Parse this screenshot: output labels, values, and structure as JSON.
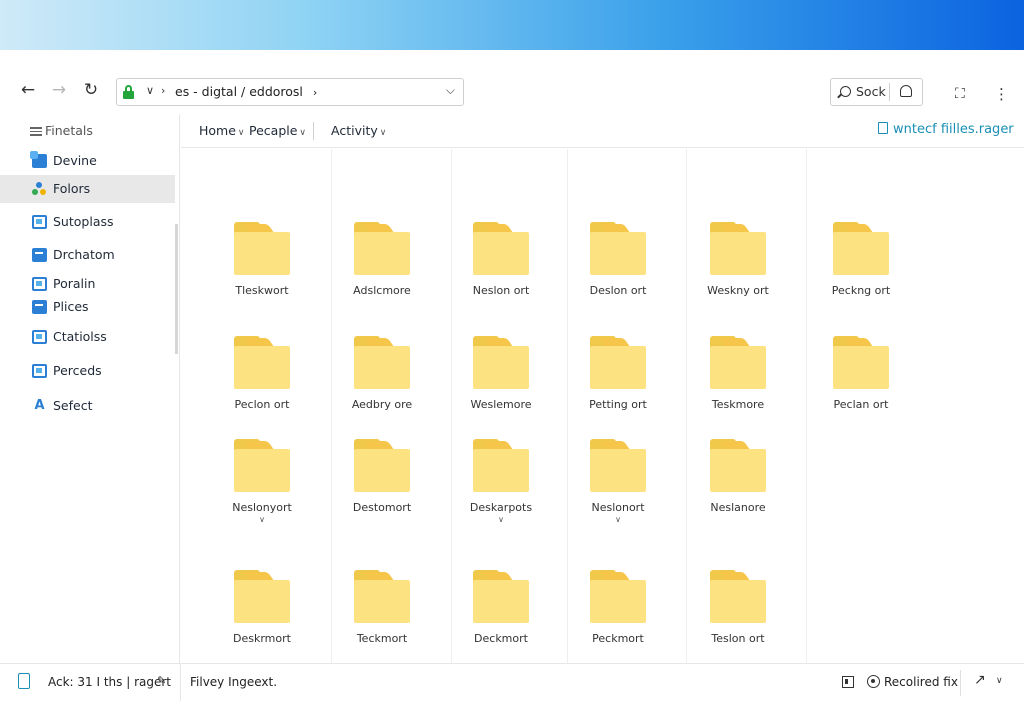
{
  "address_bar": {
    "back_icon": "arrow-left-icon",
    "forward_icon": "arrow-right-icon",
    "refresh_icon": "refresh-icon",
    "chev1": "∨",
    "chev2": "›",
    "path": "es - digtal / eddorosl",
    "path_chev": "›",
    "dropdown": "⌵"
  },
  "search": {
    "label": "Sock"
  },
  "sidebar": {
    "header": "Finetals",
    "items": [
      {
        "label": "Devine",
        "icon": "device-icon"
      },
      {
        "label": "Folors",
        "icon": "folders-icon"
      },
      {
        "label": "Sutoplass",
        "icon": "app-icon"
      },
      {
        "label": "Drchatom",
        "icon": "chart-icon"
      },
      {
        "label": "Poralin",
        "icon": "badge-icon"
      },
      {
        "label": "Plices",
        "icon": "folder-blue-icon"
      },
      {
        "label": "Ctatiolss",
        "icon": "window-icon"
      },
      {
        "label": "Perceds",
        "icon": "doc-icon"
      },
      {
        "label": "Sefect",
        "icon": "letter-a-icon"
      }
    ]
  },
  "toolbar": {
    "home": "Home",
    "people": "Pecaple",
    "activity": "Activity",
    "right_link": "wntecf fiilles.rager"
  },
  "folders": [
    "Tleskwort",
    "Adslcmore",
    "Neslon ort",
    "Deslon ort",
    "Weskny ort",
    "Peckng ort",
    "Peclon ort",
    "Aedbry ore",
    "Weslemore",
    "Petting ort",
    "Teskmore",
    "Peclan ort",
    "Neslonyort",
    "Destomort",
    "Deskarpots",
    "Neslonort",
    "Neslanore",
    "Deskrmort",
    "Teckmort",
    "Deckmort",
    "Peckmort",
    "Teslon ort"
  ],
  "status": {
    "left": "Ack: 31 I ths  | ragert",
    "mid": "Filvey Ingeext.",
    "right": "Recolired fix"
  },
  "colors": {
    "accent": "#2b7fd4",
    "link": "#1a8fb5",
    "folder": "#fde282",
    "lock": "#22a63b"
  }
}
